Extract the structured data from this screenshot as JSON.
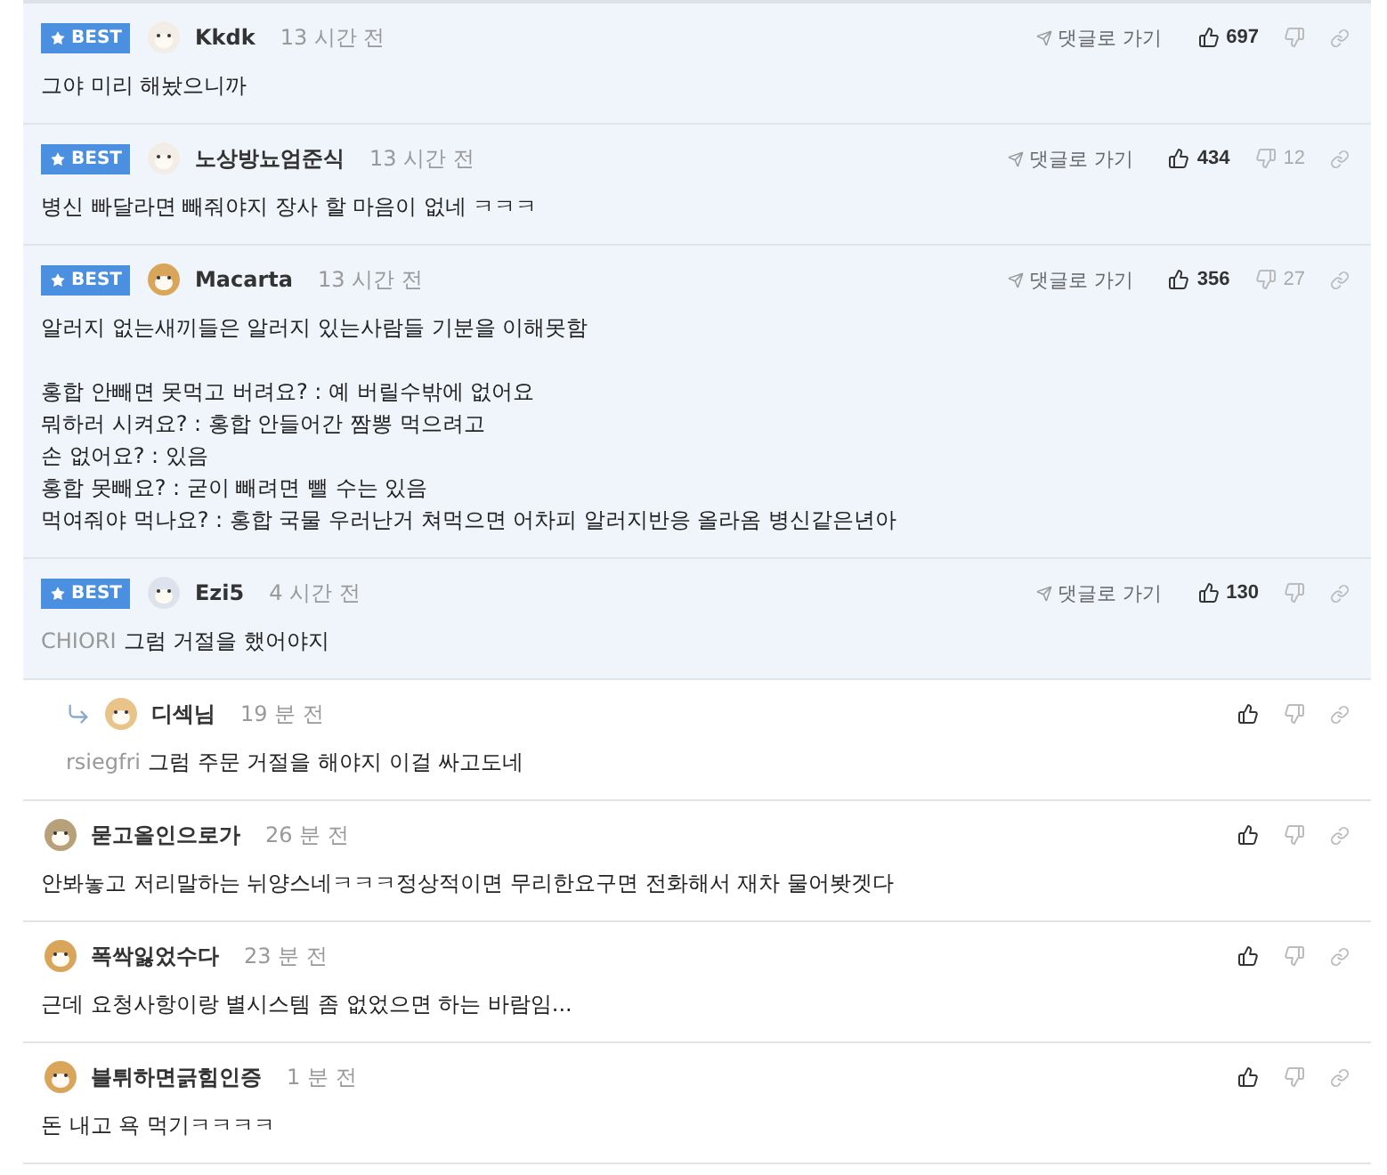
{
  "comments": [
    {
      "best": true,
      "badge": "BEST",
      "color": "#f2ede6",
      "author": "Kkdk",
      "time": "13 시간 전",
      "goto": "댓글로 가기",
      "likes": "697",
      "paragraphs": [
        [
          "그야 미리 해놨으니까"
        ]
      ]
    },
    {
      "best": true,
      "badge": "BEST",
      "color": "#f2ede6",
      "author": "노상방뇨엄준식",
      "time": "13 시간 전",
      "goto": "댓글로 가기",
      "likes": "434",
      "dislikes": "12",
      "paragraphs": [
        [
          "병신 빠달라면 빼줘야지 장사 할 마음이 없네 ㅋㅋㅋ"
        ]
      ]
    },
    {
      "best": true,
      "badge": "BEST",
      "color": "#d9a55a",
      "author": "Macarta",
      "time": "13 시간 전",
      "goto": "댓글로 가기",
      "likes": "356",
      "dislikes": "27",
      "paragraphs": [
        [
          "알러지 없는새끼들은 알러지 있는사람들 기분을 이해못함"
        ],
        [
          "홍합 안빼면 못먹고 버려요? : 예 버릴수밖에 없어요",
          "뭐하러 시켜요? : 홍합 안들어간 짬뽕 먹으려고",
          "손 없어요? : 있음",
          "홍합 못빼요? : 굳이 빼려면 뺄 수는 있음",
          "먹여줘야 먹나요? : 홍합 국물 우러난거 쳐먹으면 어차피 알러지반응 올라옴 병신같은년아"
        ]
      ]
    },
    {
      "best": true,
      "badge": "BEST",
      "color": "#dce3ec",
      "author": "Ezi5",
      "time": "4 시간 전",
      "goto": "댓글로 가기",
      "likes": "130",
      "mention": "CHIORI",
      "paragraphs": [
        [
          "그럼 거절을 했어야지"
        ]
      ],
      "children": [
        {
          "best": false,
          "color": "#e8c48a",
          "author": "디섹님",
          "time": "19 분 전",
          "mention": "rsiegfri",
          "paragraphs": [
            [
              "그럼 주문 거절을 해야지 이걸 싸고도네"
            ]
          ]
        }
      ]
    },
    {
      "best": false,
      "color": "#b8a07a",
      "author": "묻고올인으로가",
      "time": "26 분 전",
      "paragraphs": [
        [
          "안봐놓고 저리말하는 뉘양스네ㅋㅋㅋ정상적이면 무리한요구면 전화해서 재차 물어봣겟다"
        ]
      ]
    },
    {
      "best": false,
      "color": "#d9a55a",
      "author": "폭싹잃었수다",
      "time": "23 분 전",
      "paragraphs": [
        [
          "근데 요청사항이랑 별시스템 좀 없었으면 하는 바람임..."
        ]
      ]
    },
    {
      "best": false,
      "color": "#d9a55a",
      "author": "블튀하면긁힘인증",
      "time": "1 분 전",
      "paragraphs": [
        [
          "돈 내고 욕 먹기ㅋㅋㅋㅋ"
        ]
      ]
    }
  ]
}
